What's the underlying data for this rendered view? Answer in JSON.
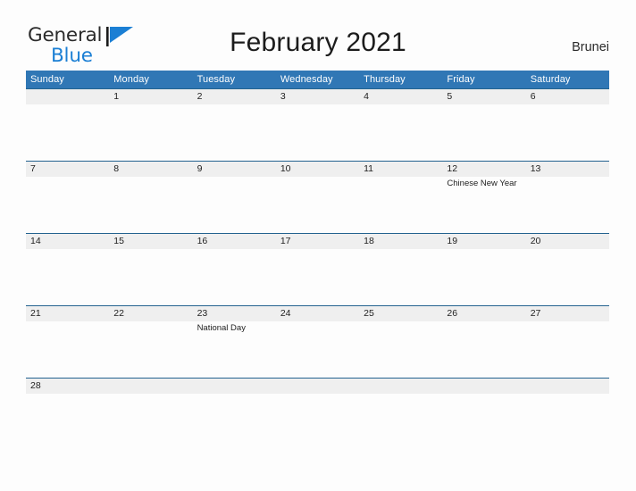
{
  "brand": {
    "word_one": "General",
    "word_two": "Blue",
    "flag_icon": "blue-flag-icon",
    "color_primary": "#1b7fd4",
    "color_text": "#2b2b2b"
  },
  "header": {
    "title": "February 2021",
    "country": "Brunei"
  },
  "theme": {
    "header_bg": "#3077b5",
    "header_text": "#ffffff",
    "daynum_bg": "#efefef",
    "week_rule": "#23628f",
    "page_bg": "#fdfdfd"
  },
  "calendar": {
    "month": "February",
    "year": "2021",
    "weekday_headers": [
      "Sunday",
      "Monday",
      "Tuesday",
      "Wednesday",
      "Thursday",
      "Friday",
      "Saturday"
    ],
    "weeks": [
      [
        {
          "day": "",
          "events": []
        },
        {
          "day": "1",
          "events": []
        },
        {
          "day": "2",
          "events": []
        },
        {
          "day": "3",
          "events": []
        },
        {
          "day": "4",
          "events": []
        },
        {
          "day": "5",
          "events": []
        },
        {
          "day": "6",
          "events": []
        }
      ],
      [
        {
          "day": "7",
          "events": []
        },
        {
          "day": "8",
          "events": []
        },
        {
          "day": "9",
          "events": []
        },
        {
          "day": "10",
          "events": []
        },
        {
          "day": "11",
          "events": []
        },
        {
          "day": "12",
          "events": [
            "Chinese New Year"
          ]
        },
        {
          "day": "13",
          "events": []
        }
      ],
      [
        {
          "day": "14",
          "events": []
        },
        {
          "day": "15",
          "events": []
        },
        {
          "day": "16",
          "events": []
        },
        {
          "day": "17",
          "events": []
        },
        {
          "day": "18",
          "events": []
        },
        {
          "day": "19",
          "events": []
        },
        {
          "day": "20",
          "events": []
        }
      ],
      [
        {
          "day": "21",
          "events": []
        },
        {
          "day": "22",
          "events": []
        },
        {
          "day": "23",
          "events": [
            "National Day"
          ]
        },
        {
          "day": "24",
          "events": []
        },
        {
          "day": "25",
          "events": []
        },
        {
          "day": "26",
          "events": []
        },
        {
          "day": "27",
          "events": []
        }
      ],
      [
        {
          "day": "28",
          "events": []
        },
        {
          "day": "",
          "events": []
        },
        {
          "day": "",
          "events": []
        },
        {
          "day": "",
          "events": []
        },
        {
          "day": "",
          "events": []
        },
        {
          "day": "",
          "events": []
        },
        {
          "day": "",
          "events": []
        }
      ]
    ]
  }
}
